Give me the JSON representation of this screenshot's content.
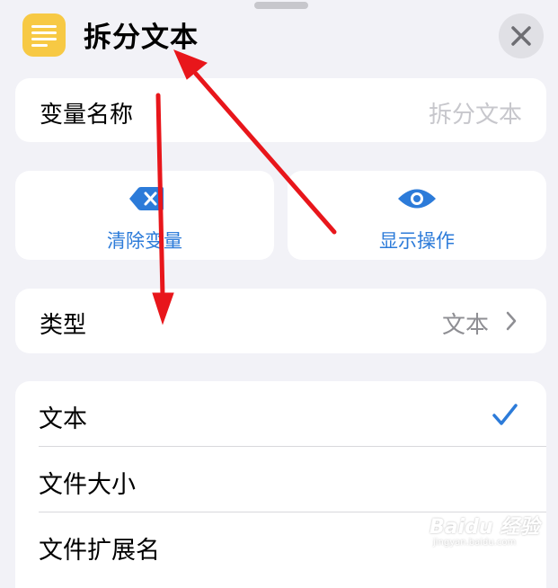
{
  "header": {
    "title": "拆分文本",
    "app_icon": "text-lines-icon",
    "close_icon": "close-icon"
  },
  "variable_name": {
    "label": "变量名称",
    "placeholder": "拆分文本"
  },
  "actions": {
    "clear": {
      "label": "清除变量",
      "icon": "clear-backspace-icon"
    },
    "show": {
      "label": "显示操作",
      "icon": "eye-icon"
    }
  },
  "type_row": {
    "label": "类型",
    "value": "文本",
    "chevron": "chevron-right-icon"
  },
  "type_options": [
    {
      "label": "文本",
      "selected": true
    },
    {
      "label": "文件大小",
      "selected": false
    },
    {
      "label": "文件扩展名",
      "selected": false
    }
  ],
  "watermark": {
    "brand": "Baidu 经验",
    "url": "jingyan.baidu.com"
  },
  "colors": {
    "accent": "#2c7bd9",
    "app_icon": "#f7c944",
    "annotation_arrow": "#e8161b"
  }
}
